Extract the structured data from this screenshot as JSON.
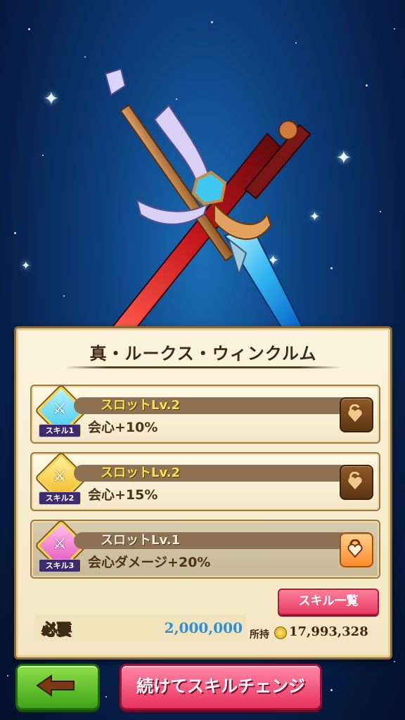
{
  "weapon_name": "真・ルークス・ウィンクルム",
  "skills": [
    {
      "slot_label": "スロットLv.2",
      "effect": "会心+10%",
      "badge": "スキル1",
      "gem_color": "#3fc8e8",
      "lock_state": "unlocked"
    },
    {
      "slot_label": "スロットLv.2",
      "effect": "会心+15%",
      "badge": "スキル2",
      "gem_color": "#f2b51a",
      "lock_state": "unlocked"
    },
    {
      "slot_label": "スロットLv.1",
      "effect": "会心ダメージ+20%",
      "badge": "スキル3",
      "gem_color": "#e24fb8",
      "lock_state": "locked"
    }
  ],
  "skill_list_button": "スキル一覧",
  "cost": {
    "label": "必要",
    "value": "2,000,000"
  },
  "owned": {
    "label": "所持",
    "value": "17,993,328"
  },
  "buttons": {
    "back_icon": "left-arrow-icon",
    "continue": "続けてスキルチェンジ"
  },
  "colors": {
    "back_button": "#4cb524",
    "continue_button": "#ee3f6a",
    "cost_value": "#2e8fd8"
  }
}
